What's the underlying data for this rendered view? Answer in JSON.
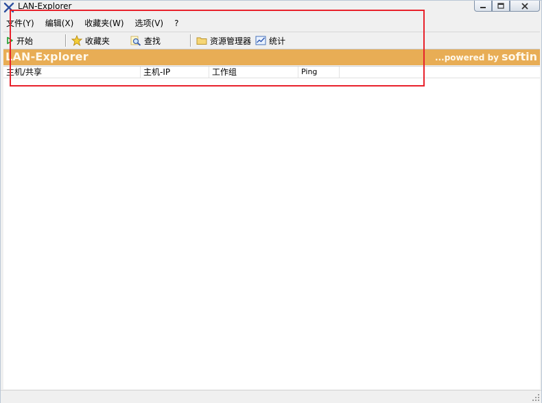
{
  "window": {
    "title": "LAN-Explorer"
  },
  "menu": [
    {
      "label": "文件(Y)"
    },
    {
      "label": "编辑(X)"
    },
    {
      "label": "收藏夹(W)"
    },
    {
      "label": "选项(V)"
    },
    {
      "label": "?"
    }
  ],
  "toolbar": {
    "start": {
      "label": "开始",
      "icon": "play-icon"
    },
    "favorites": {
      "label": "收藏夹",
      "icon": "star-icon"
    },
    "find": {
      "label": "查找",
      "icon": "magnifier-icon"
    },
    "explorer": {
      "label": "资源管理器",
      "icon": "folder-icon"
    },
    "stats": {
      "label": "统计",
      "icon": "chart-icon"
    }
  },
  "banner": {
    "title": "LAN-Explorer",
    "powered": "...powered by",
    "brand": "softin",
    "color": "#e8ad55"
  },
  "columns": [
    {
      "label": "主机/共享"
    },
    {
      "label": "主机-IP"
    },
    {
      "label": "工作组"
    },
    {
      "label": "Ping"
    }
  ],
  "annotation_color": "#e8202a"
}
